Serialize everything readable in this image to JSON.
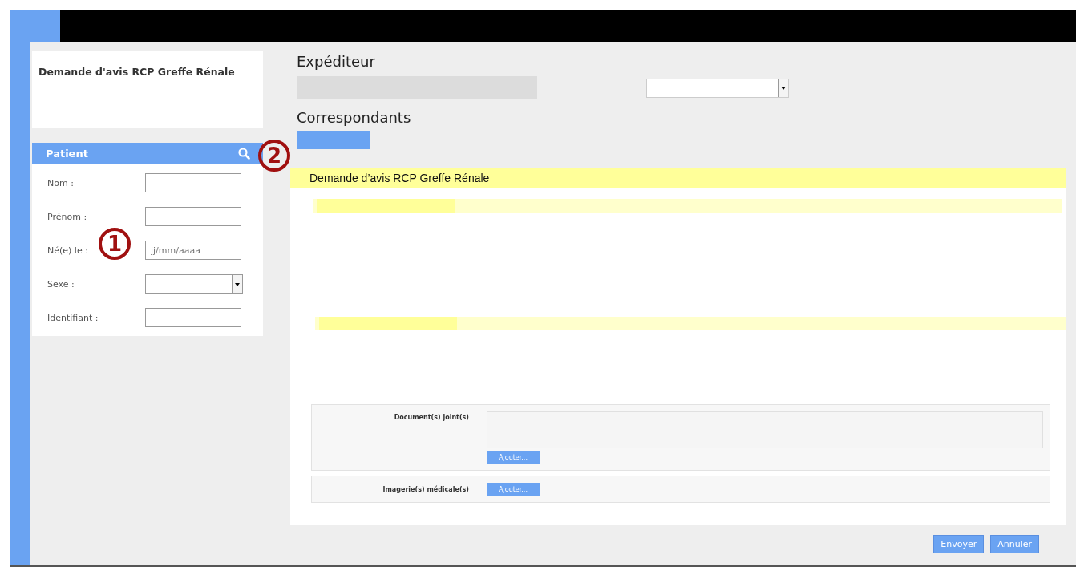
{
  "form_title": "Demande d'avis RCP Greffe Rénale",
  "patient": {
    "title": "Patient",
    "fields": [
      {
        "label": "Nom :",
        "kind": "text"
      },
      {
        "label": "Prénom :",
        "kind": "text"
      },
      {
        "label": "Né(e) le :",
        "kind": "text",
        "placeholder": "jj/mm/aaaa"
      },
      {
        "label": "Sexe :",
        "kind": "select"
      },
      {
        "label": "Identifiant :",
        "kind": "text"
      }
    ]
  },
  "sender": {
    "heading": "Expéditeur"
  },
  "recipients": {
    "heading": "Correspondants"
  },
  "request": {
    "title": "Demande d’avis RCP Greffe Rénale",
    "attachments": [
      {
        "label": "Document(s) joint(s)",
        "kind": "list",
        "button": "Ajouter..."
      },
      {
        "label": "Imagerie(s) médicale(s)",
        "kind": "inline",
        "button": "Ajouter..."
      }
    ]
  },
  "buttons": [
    "Envoyer",
    "Annuler"
  ],
  "callouts": [
    {
      "number": "1"
    },
    {
      "number": "2"
    }
  ]
}
